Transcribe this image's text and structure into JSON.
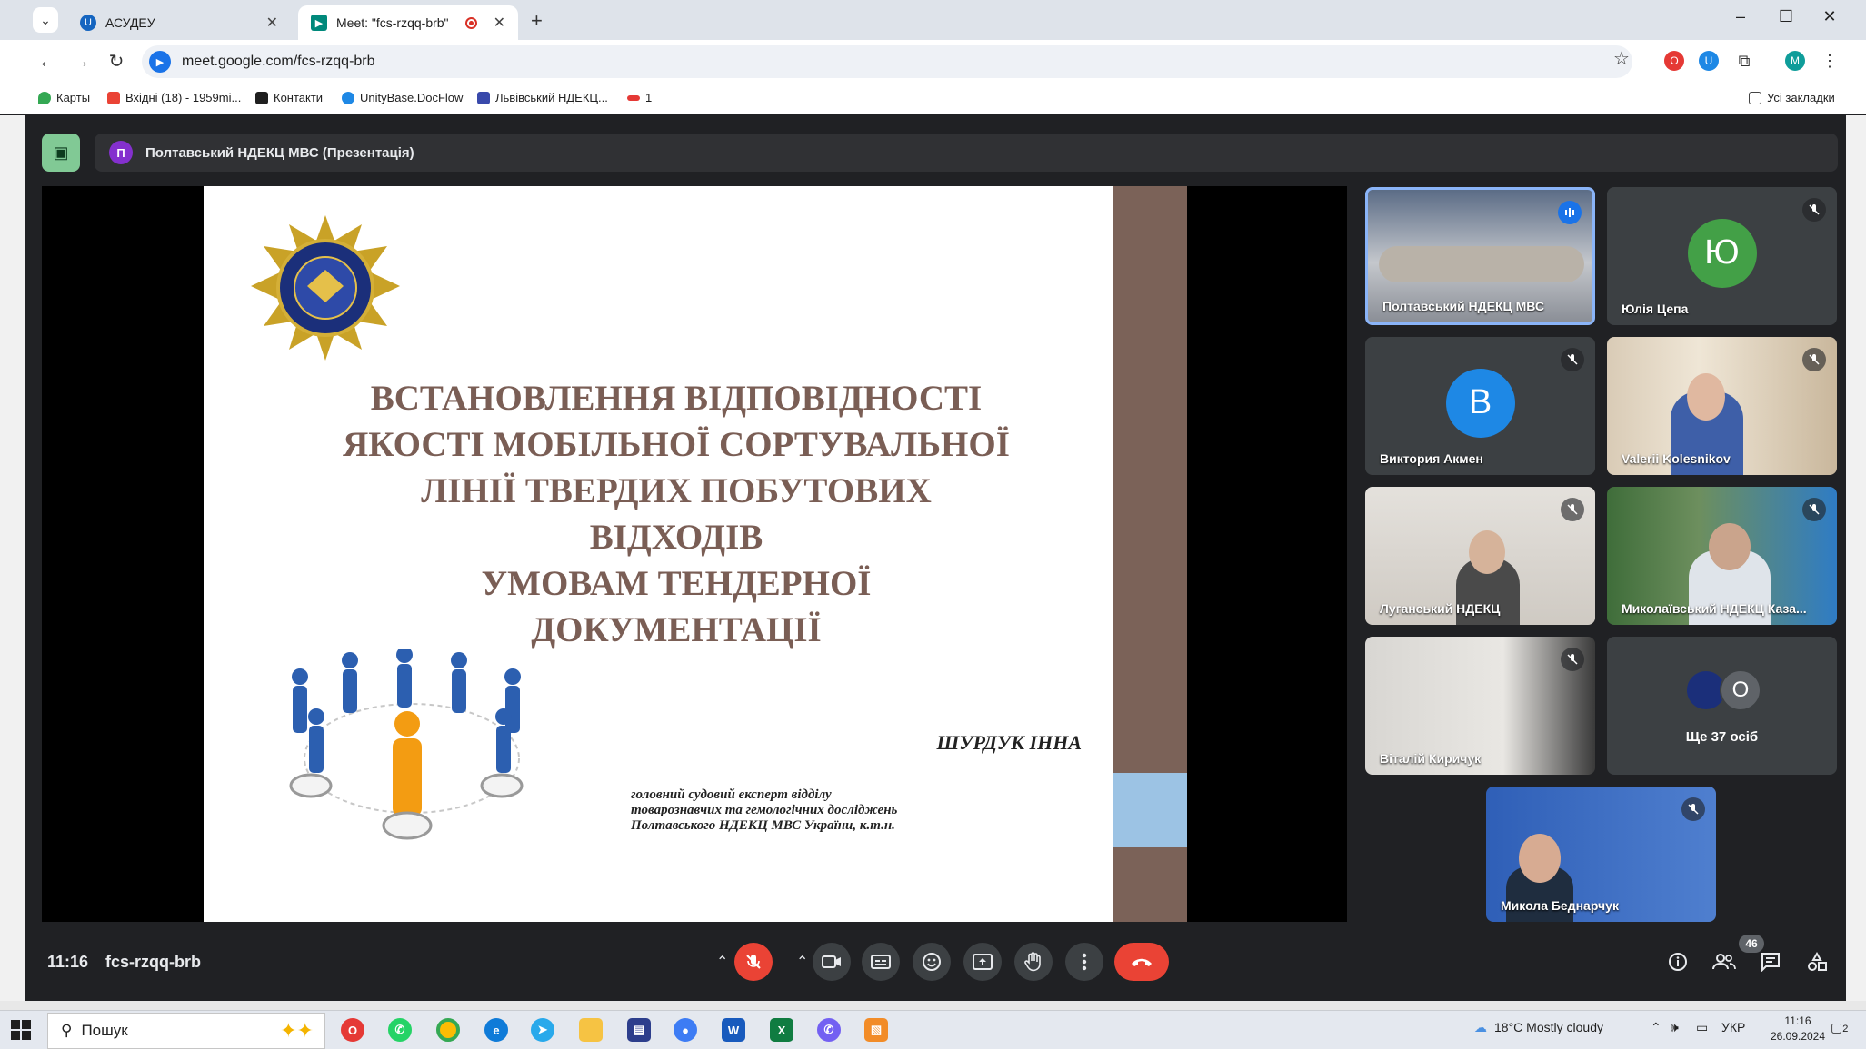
{
  "browser": {
    "tabs": [
      {
        "label": "АСУДЕУ",
        "active": false
      },
      {
        "label": "Meet: \"fcs-rzqq-brb\"",
        "active": true
      }
    ],
    "url": "meet.google.com/fcs-rzqq-brb",
    "bookmarks": [
      {
        "label": "Карты",
        "icon": "maps-pin-icon"
      },
      {
        "label": "Вхідні (18) - 1959mi...",
        "icon": "gmail-icon"
      },
      {
        "label": "Контакти",
        "icon": "contacts-icon"
      },
      {
        "label": "UnityBase.DocFlow",
        "icon": "unitybase-icon"
      },
      {
        "label": "Львівський НДЕКЦ...",
        "icon": "shield-icon"
      },
      {
        "label": "1",
        "icon": "bookmark-bar-icon"
      }
    ],
    "all_bookmarks": "Усі закладки",
    "profile_initial": "M"
  },
  "meet": {
    "presenter_initial": "П",
    "presentation_title": "Полтавський НДЕКЦ МВС (Презентація)",
    "slide": {
      "title_lines": [
        "Встановлення відповідності",
        "якості мобільної сортувальної",
        "лінії твердих побутових відходів",
        "умовам тендерної документації"
      ],
      "author": "ШУРДУК ІННА",
      "position_lines": [
        "головний судовий експерт відділу",
        "товарознавчих та гемологічних досліджень",
        "Полтавського НДЕКЦ МВС України, к.т.н."
      ]
    },
    "participants": [
      {
        "name": "Полтавський НДЕКЦ МВС",
        "speaking": true
      },
      {
        "name": "Юлія Цепа",
        "avatar_letter": "Ю",
        "avatar_color": "#43a047",
        "muted": true
      },
      {
        "name": "Виктория Акмен",
        "avatar_letter": "В",
        "avatar_color": "#1e88e5",
        "muted": true
      },
      {
        "name": "Valerii Kolesnikov",
        "muted": true
      },
      {
        "name": "Луганський НДЕКЦ",
        "muted": true
      },
      {
        "name": "Миколаївський НДЕКЦ Каза...",
        "muted": true
      },
      {
        "name": "Віталій Киричук",
        "muted": true
      },
      {
        "name": "Ще 37 осіб",
        "avatar_letter": "О"
      },
      {
        "name": "Микола Беднарчук",
        "muted": true
      }
    ],
    "time": "11:16",
    "meeting_code": "fcs-rzqq-brb",
    "participant_count": "46"
  },
  "taskbar": {
    "search_placeholder": "Пошук",
    "weather": "18°C  Mostly cloudy",
    "language": "УКР",
    "time": "11:16",
    "date": "26.09.2024",
    "notifications": "2"
  },
  "colors": {
    "end_call": "#ea4335",
    "mic_off": "#ea4335",
    "speaking_border": "#8ab4f8"
  }
}
